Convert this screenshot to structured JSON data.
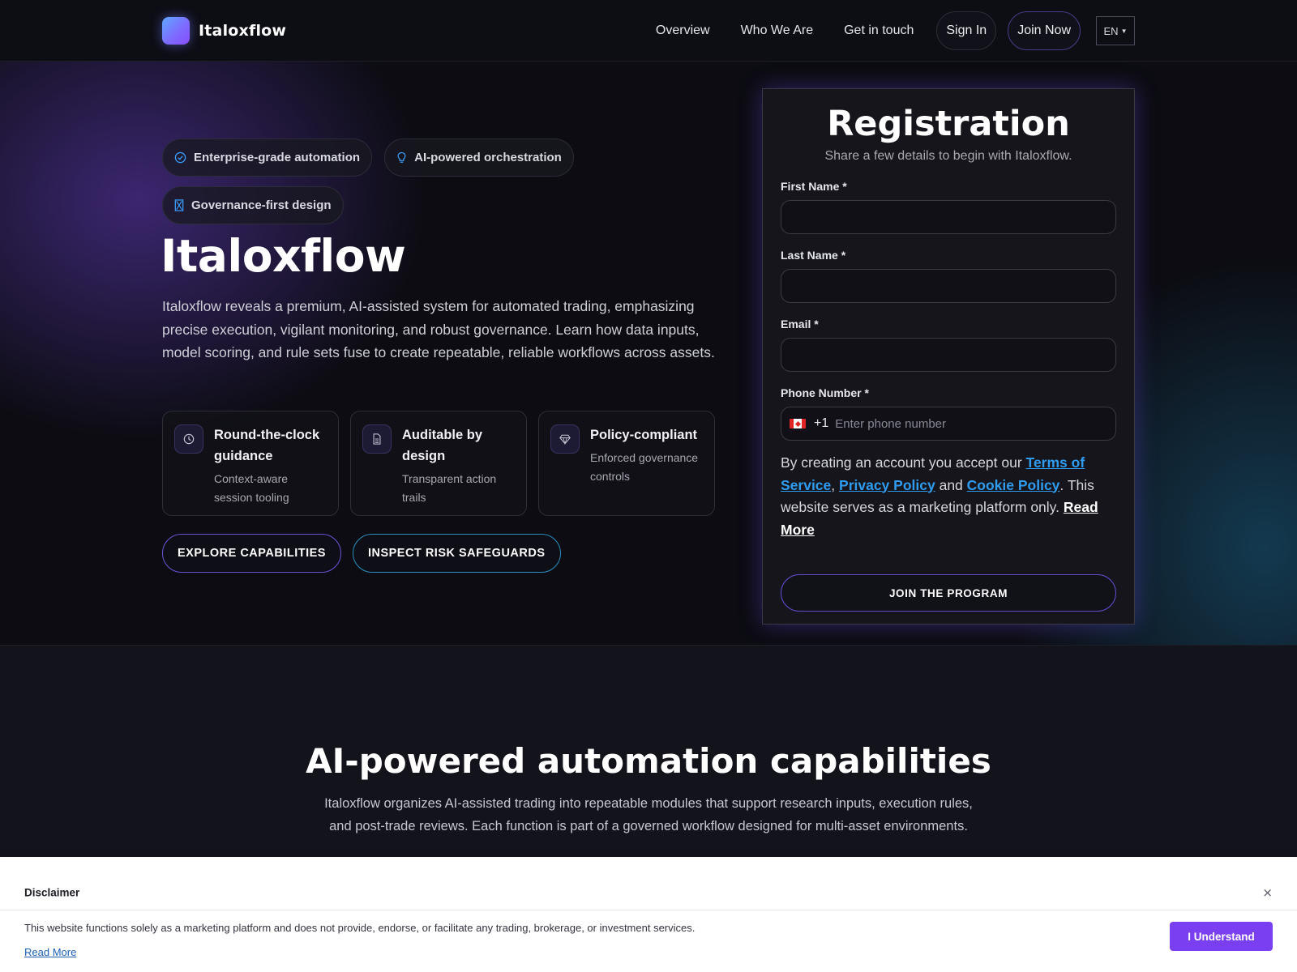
{
  "brand": {
    "name": "Italoxflow"
  },
  "nav": {
    "links": [
      "Overview",
      "Who We Are",
      "Get in touch"
    ],
    "sign_in": "Sign In",
    "join_now": "Join Now",
    "language": "EN"
  },
  "hero": {
    "badges": [
      {
        "label": "Enterprise-grade automation",
        "icon": "check-circle-icon"
      },
      {
        "label": "AI-powered orchestration",
        "icon": "lightbulb-icon"
      },
      {
        "label": "Governance-first design",
        "icon": "hourglass-icon"
      }
    ],
    "title": "Italoxflow",
    "description": "Italoxflow reveals a premium, AI-assisted system for automated trading, emphasizing precise execution, vigilant monitoring, and robust governance. Learn how data inputs, model scoring, and rule sets fuse to create repeatable, reliable workflows across assets.",
    "features": [
      {
        "title": "Round-the-clock guidance",
        "subtitle": "Context-aware session tooling",
        "icon": "clock-icon"
      },
      {
        "title": "Auditable by design",
        "subtitle": "Transparent action trails",
        "icon": "document-icon"
      },
      {
        "title": "Policy-compliant",
        "subtitle": "Enforced governance controls",
        "icon": "diamond-icon"
      }
    ],
    "cta_primary": "EXPLORE CAPABILITIES",
    "cta_secondary": "INSPECT RISK SAFEGUARDS"
  },
  "registration": {
    "title": "Registration",
    "subtitle": "Share a few details to begin with Italoxflow.",
    "first_name_label": "First Name *",
    "first_name_value": "",
    "last_name_label": "Last Name *",
    "last_name_value": "",
    "email_label": "Email *",
    "email_value": "",
    "phone_label": "Phone Number *",
    "phone_country_code": "+1",
    "phone_flag": "canada-flag-icon",
    "phone_placeholder": "Enter phone number",
    "consent": {
      "prefix": "By creating an account you accept our ",
      "terms": "Terms of Service",
      "comma": ", ",
      "privacy": "Privacy Policy",
      "and": " and ",
      "cookie": "Cookie Policy",
      "suffix": ". This website serves as a marketing platform only. ",
      "read_more": "Read More"
    },
    "submit": "JOIN THE PROGRAM"
  },
  "capabilities": {
    "title": "AI-powered automation capabilities",
    "description": "Italoxflow organizes AI-assisted trading into repeatable modules that support research inputs, execution rules, and post-trade reviews. Each function is part of a governed workflow designed for multi-asset environments."
  },
  "disclaimer": {
    "title": "Disclaimer",
    "text": "This website functions solely as a marketing platform and does not provide, endorse, or facilitate any trading, brokerage, or investment services.",
    "read_more": "Read More",
    "button": "I Understand",
    "close": "×"
  },
  "colors": {
    "accent_purple": "#7a3ff0",
    "link_blue": "#2f9cf0",
    "badge_icon_blue": "#3aa0ff"
  }
}
